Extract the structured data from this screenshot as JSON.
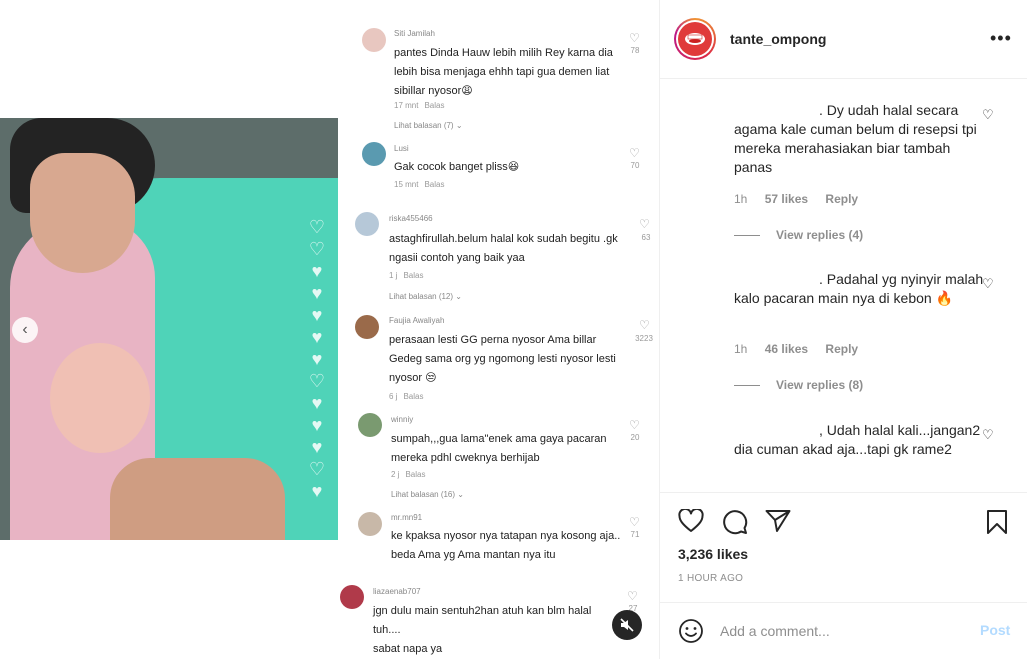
{
  "post": {
    "username": "tante_ompong",
    "likes": "3,236 likes",
    "time": "1 HOUR AGO",
    "comment_placeholder": "Add a comment...",
    "post_label": "Post"
  },
  "right_comments": [
    {
      "text": ". Dy udah halal secara agama kale cuman belum di resepsi tpi mereka merahasiakan biar tambah panas",
      "time": "1h",
      "likes": "57 likes",
      "reply": "Reply",
      "view_replies": "View replies (4)"
    },
    {
      "text": ". Padahal yg nyinyir malah kalo pacaran main nya di kebon 🔥",
      "time": "1h",
      "likes": "46 likes",
      "reply": "Reply",
      "view_replies": "View replies (8)"
    },
    {
      "text": ", Udah halal kali...jangan2 dia cuman akad aja...tapi gk rame2"
    }
  ],
  "screenshot_comments": [
    {
      "user": "Siti Jamilah",
      "text": "pantes Dinda Hauw lebih milih Rey karna dia lebih bisa menjaga ehhh tapi gua demen liat sibillar nyosor😩",
      "time": "17 mnt",
      "reply": "Balas",
      "heart_count": "78"
    },
    {
      "user": "Lusi",
      "text": "Gak cocok banget pliss😆",
      "time": "15 mnt",
      "reply": "Balas",
      "heart_count": "70"
    },
    {
      "user": "riska455466",
      "text": "astaghfirullah.belum halal kok sudah begitu .gk ngasii contoh yang baik yaa",
      "time": "1 j",
      "reply": "Balas",
      "heart_count": "63"
    },
    {
      "user": "Faujia Awaliyah",
      "text": "perasaan lesti GG perna nyosor Ama billar Gedeg sama org yg ngomong lesti nyosor lesti nyosor 😒",
      "time": "6 j",
      "reply": "Balas",
      "heart_count": "3223"
    },
    {
      "user": "winniy",
      "text": "sumpah,,,gua lama\"enek ama gaya pacaran mereka pdhl cweknya berhijab",
      "time": "2 j",
      "reply": "Balas",
      "heart_count": "20"
    },
    {
      "user": "mr.mn91",
      "text": "ke kpaksa nyosor nya tatapan nya kosong aja.. beda Ama yg Ama mantan nya itu",
      "heart_count": "71"
    },
    {
      "user": "liazaenab707",
      "text": "jgn dulu main sentuh2han atuh kan blm halal tuh....",
      "text2": "sabat napa ya",
      "heart_count": "27"
    }
  ],
  "see_replies": [
    "Lihat balasan (7)",
    "Lihat balasan (12)",
    "Lihat balasan (16)"
  ],
  "colors": {
    "accent": "#0095f6",
    "post_disabled": "#b3dbff",
    "border": "#efefef",
    "muted": "#8e8e8e"
  }
}
